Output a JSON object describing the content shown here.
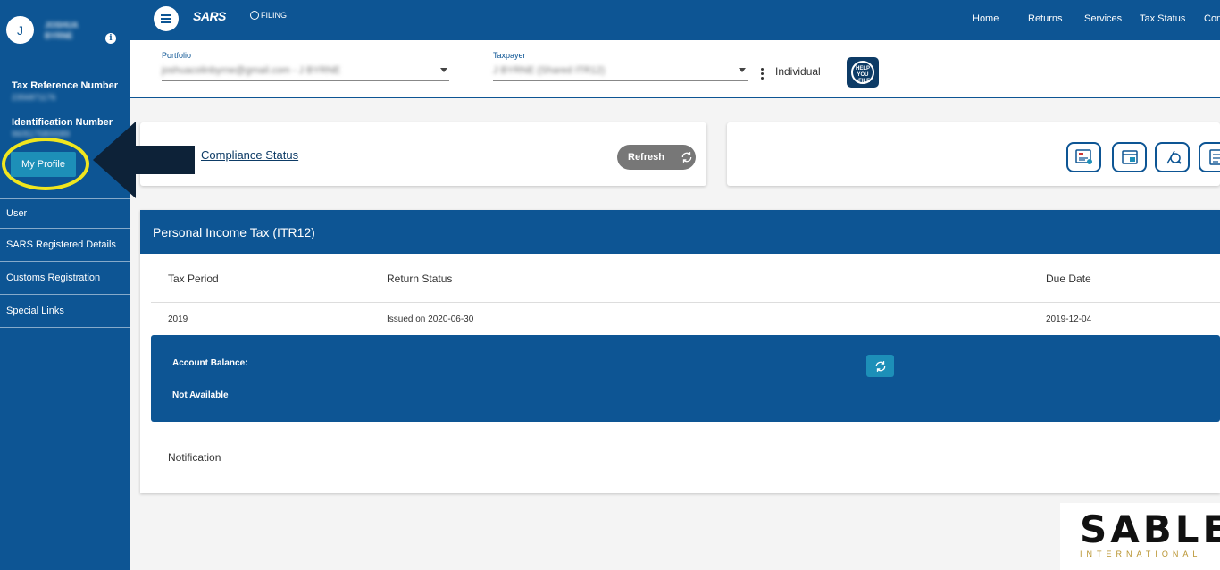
{
  "sidebar": {
    "avatar_initial": "J",
    "user_name": "JOSHUA BYRNE",
    "tax_ref_label": "Tax Reference Number",
    "tax_ref_value": "2356871176",
    "id_label": "Identification Number",
    "id_value": "9605175800089",
    "profile_button": "My Profile",
    "items": [
      {
        "label": "User"
      },
      {
        "label": "SARS Registered Details"
      },
      {
        "label": "Customs Registration"
      },
      {
        "label": "Special Links"
      }
    ]
  },
  "topbar": {
    "logo": "SARS",
    "efiling": "FILING",
    "nav": [
      "Home",
      "Returns",
      "Services",
      "Tax Status",
      "Con"
    ]
  },
  "selectors": {
    "portfolio_label": "Portfolio",
    "portfolio_value": "joshuacolinbyrne@gmail.com - J BYRNE",
    "taxpayer_label": "Taxpayer",
    "taxpayer_value": "J BYRNE (Shared ITR12)",
    "type": "Individual",
    "help_badge": "HELP YOU eFILE"
  },
  "compliance": {
    "title": "Compliance Status",
    "refresh": "Refresh"
  },
  "itr": {
    "title": "Personal Income Tax (ITR12)",
    "columns": [
      "Tax Period",
      "Return Status",
      "Due Date"
    ],
    "row": {
      "period": "2019",
      "status": "Issued on 2020-06-30",
      "due": "2019-12-04"
    },
    "account_balance_label": "Account Balance:",
    "account_balance_value": "Not Available",
    "notification": "Notification"
  },
  "watermark": {
    "main": "SABLE",
    "sub": "INTERNATIONAL"
  },
  "colors": {
    "primary": "#0d5594",
    "accent": "#1d8fb8",
    "highlight": "#f0e61e"
  }
}
